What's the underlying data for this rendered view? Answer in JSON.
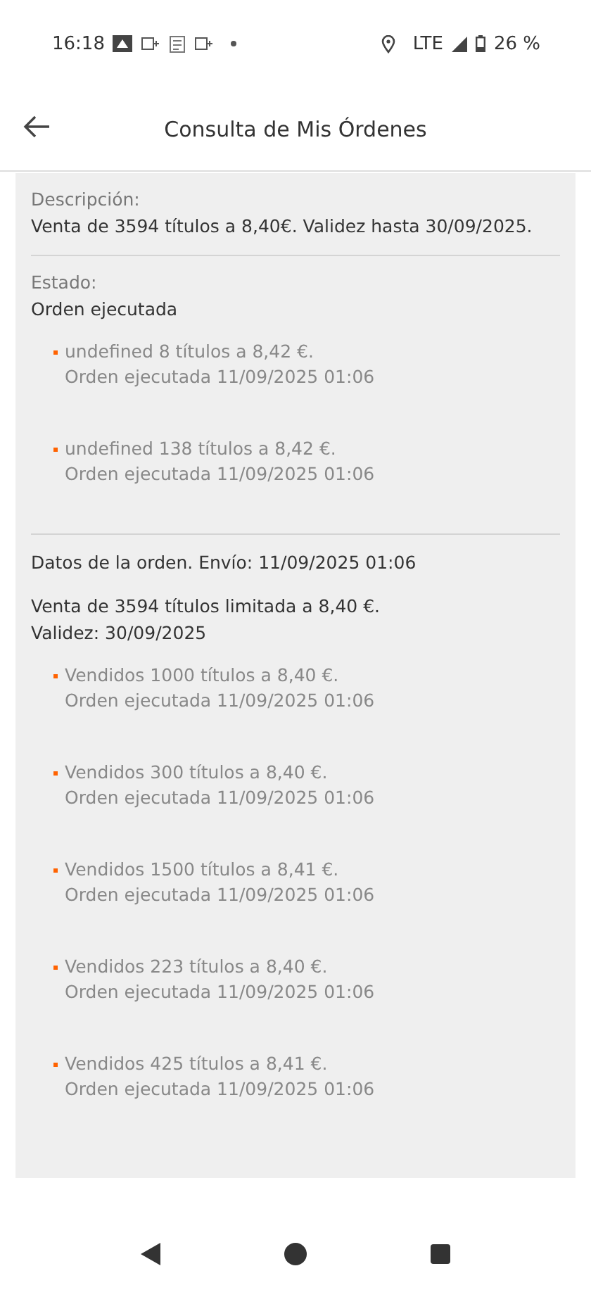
{
  "status_bar": {
    "time": "16:18",
    "network": "LTE",
    "battery": "26 %"
  },
  "header": {
    "title": "Consulta de Mis Órdenes"
  },
  "description": {
    "label": "Descripción:",
    "value": "Venta de 3594 títulos a 8,40€. Validez hasta 30/09/2025."
  },
  "state": {
    "label": "Estado:",
    "value": "Orden ejecutada",
    "executions": [
      {
        "line1": "undefined 8 títulos a 8,42 €.",
        "line2": "Orden ejecutada 11/09/2025 01:06"
      },
      {
        "line1": "undefined 138 títulos a 8,42 €.",
        "line2": "Orden ejecutada 11/09/2025 01:06"
      }
    ]
  },
  "order_data": {
    "title": "Datos de la orden. Envío: 11/09/2025 01:06",
    "summary_line1": "Venta de 3594 títulos limitada a 8,40 €.",
    "summary_line2": "Validez: 30/09/2025",
    "executions": [
      {
        "line1": "Vendidos 1000 títulos a 8,40 €.",
        "line2": "Orden ejecutada 11/09/2025 01:06"
      },
      {
        "line1": "Vendidos 300 títulos a 8,40 €.",
        "line2": "Orden ejecutada 11/09/2025 01:06"
      },
      {
        "line1": "Vendidos 1500 títulos a 8,41 €.",
        "line2": "Orden ejecutada 11/09/2025 01:06"
      },
      {
        "line1": "Vendidos 223 títulos a 8,40 €.",
        "line2": "Orden ejecutada 11/09/2025 01:06"
      },
      {
        "line1": "Vendidos 425 títulos a 8,41 €.",
        "line2": "Orden ejecutada 11/09/2025 01:06"
      }
    ]
  }
}
